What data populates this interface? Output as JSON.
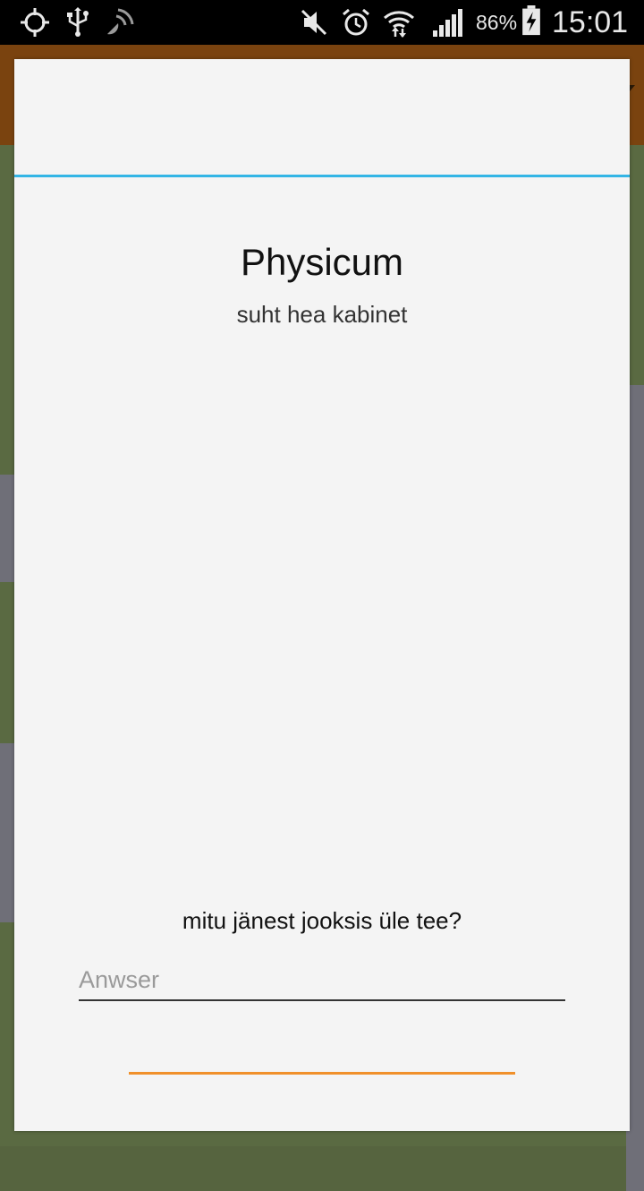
{
  "status_bar": {
    "battery_percent": "86%",
    "time": "15:01",
    "icons": [
      "location-crosshair-icon",
      "usb-icon",
      "nfc-icon",
      "mute-icon",
      "alarm-icon",
      "wifi-icon",
      "cell-signal-icon",
      "battery-charging-icon"
    ]
  },
  "dialog": {
    "title": "Physicum",
    "subtitle": "suht hea kabinet",
    "question": "mitu jänest jooksis üle tee?",
    "answer_placeholder": "Anwser",
    "answer_value": "",
    "submit_label": ""
  },
  "colors": {
    "divider": "#33b5e5",
    "button_underline": "#f0902a",
    "app_bar": "#7a430f",
    "dialog_bg": "#f4f4f4"
  }
}
